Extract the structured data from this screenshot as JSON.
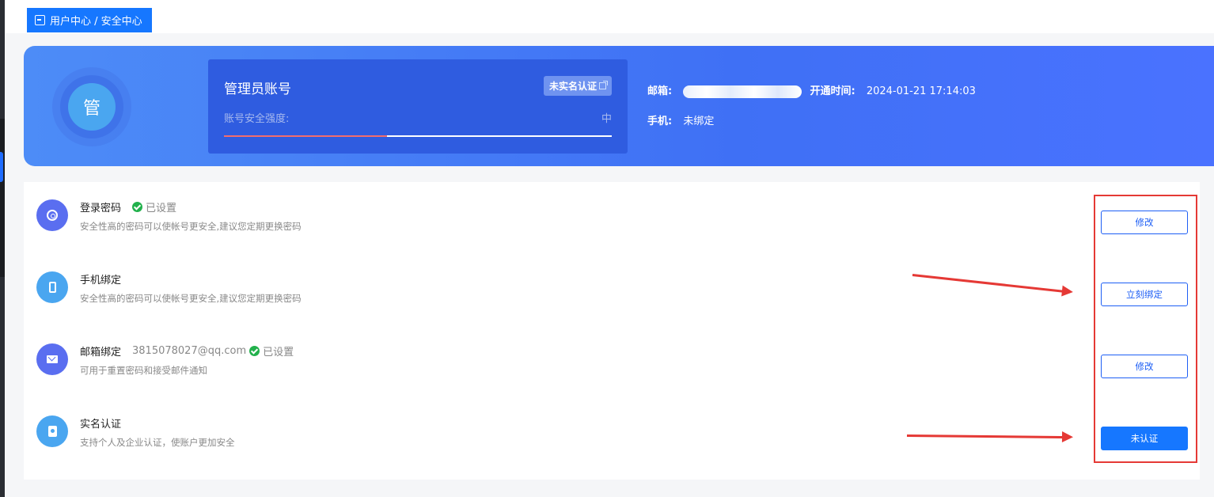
{
  "breadcrumb": {
    "text": "用户中心 / 安全中心"
  },
  "hero": {
    "avatar_char": "管",
    "account_title": "管理员账号",
    "realname_badge": "未实名认证",
    "strength_label": "账号安全强度:",
    "strength_level": "中",
    "strength_progress": 0.42,
    "email_key": "邮箱:",
    "open_time_key": "开通时间:",
    "open_time_value": "2024-01-21 17:14:03",
    "phone_key": "手机:",
    "phone_value": "未绑定"
  },
  "items": [
    {
      "title": "登录密码",
      "extra": "已设置",
      "desc": "安全性高的密码可以使帐号更安全,建议您定期更换密码",
      "button": "修改",
      "icon": "fingerprint-icon",
      "color": "#5a6ef0"
    },
    {
      "title": "手机绑定",
      "extra": "",
      "desc": "安全性高的密码可以使帐号更安全,建议您定期更换密码",
      "button": "立刻绑定",
      "icon": "phone-icon",
      "color": "#4aa6f0"
    },
    {
      "title": "邮箱绑定",
      "email": "3815078027@qq.com",
      "extra": "已设置",
      "desc": "可用于重置密码和接受邮件通知",
      "button": "修改",
      "icon": "mail-icon",
      "color": "#5a6ef0"
    },
    {
      "title": "实名认证",
      "extra": "",
      "desc": "支持个人及企业认证，使账户更加安全",
      "button": "未认证",
      "icon": "id-card-icon",
      "color": "#4aa6f0"
    }
  ],
  "colors": {
    "primary": "#1677ff",
    "success": "#22b14c",
    "annotation": "#e53935"
  }
}
